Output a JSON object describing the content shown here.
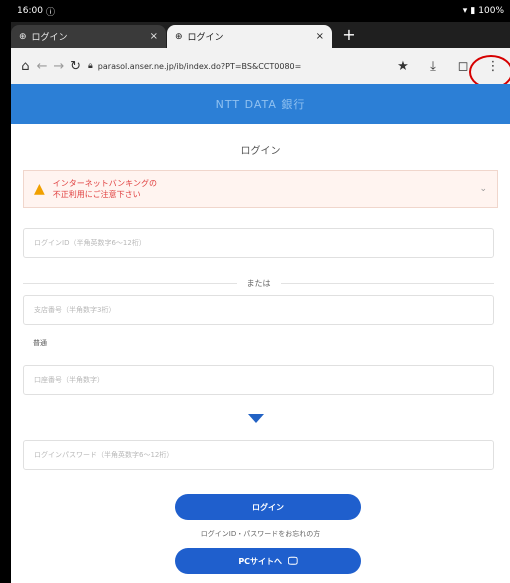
{
  "status_bar": {
    "time": "16:00",
    "battery": "100%"
  },
  "tabs": [
    {
      "title": "ログイン",
      "close": "×"
    },
    {
      "title": "ログイン",
      "close": "×"
    }
  ],
  "new_tab": "+",
  "toolbar": {
    "url": "parasol.anser.ne.jp/ib/index.do?PT=BS&CCT0080="
  },
  "page": {
    "header_title": "NTT DATA 銀行",
    "login_heading": "ログイン",
    "warning_text_line1": "インターネットバンキングの",
    "warning_text_line2": "不正利用にご注意下さい",
    "login_id_placeholder": "ログインID（半角英数字6〜12桁）",
    "or_text": "または",
    "branch_placeholder": "支店番号（半角数字3桁）",
    "account_type_label": "普通",
    "account_placeholder": "口座番号（半角数字）",
    "password_placeholder": "ログインパスワード（半角英数字6〜12桁）",
    "login_button": "ログイン",
    "forgot_link": "ログインID・パスワードをお忘れの方",
    "pc_site_button": "PCサイトへ"
  }
}
